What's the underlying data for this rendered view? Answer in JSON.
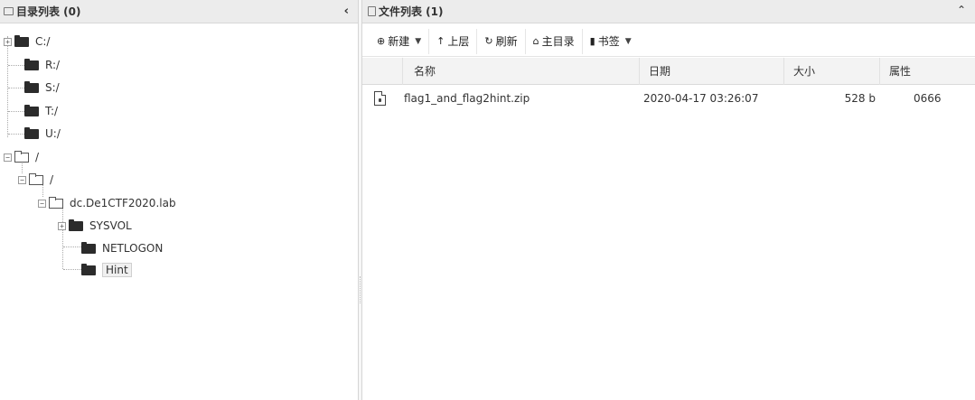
{
  "left_panel": {
    "title": "目录列表 (0)",
    "collapse_icon": "chevron-left-icon",
    "tree": [
      {
        "label": "C:/",
        "expander": "+"
      },
      {
        "label": "R:/"
      },
      {
        "label": "S:/"
      },
      {
        "label": "T:/"
      },
      {
        "label": "U:/"
      },
      {
        "label": "/",
        "expander": "-"
      },
      {
        "label": "/",
        "expander": "-"
      },
      {
        "label": "dc.De1CTF2020.lab",
        "expander": "-"
      },
      {
        "label": "SYSVOL",
        "expander": "+"
      },
      {
        "label": "NETLOGON"
      },
      {
        "label": "Hint",
        "selected": true
      }
    ]
  },
  "right_panel": {
    "title": "文件列表 (1)",
    "collapse_icon": "chevron-up-icon",
    "toolbar": {
      "new_label": "新建",
      "up_label": "上层",
      "refresh_label": "刷新",
      "home_label": "主目录",
      "bookmark_label": "书签"
    },
    "columns": {
      "name": "名称",
      "date": "日期",
      "size": "大小",
      "attr": "属性"
    },
    "files": [
      {
        "name": "flag1_and_flag2hint.zip",
        "date": "2020-04-17 03:26:07",
        "size": "528 b",
        "attr": "0666",
        "icon": "zip-file-icon"
      }
    ]
  }
}
